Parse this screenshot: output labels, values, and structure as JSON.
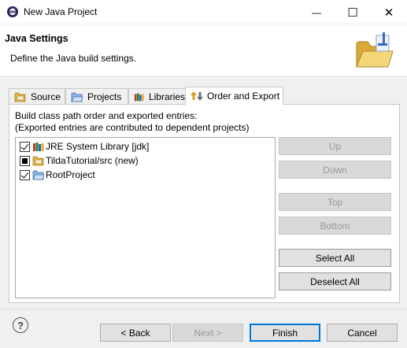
{
  "window": {
    "title": "New Java Project",
    "controls": {
      "minimize": "—",
      "maximize": "☐",
      "close": "✕"
    }
  },
  "header": {
    "title": "Java Settings",
    "subtitle": "Define the Java build settings."
  },
  "tabs": [
    {
      "label": "Source",
      "icon": "source-folder-icon",
      "active": false
    },
    {
      "label": "Projects",
      "icon": "projects-folder-icon",
      "active": false
    },
    {
      "label": "Libraries",
      "icon": "libraries-icon",
      "active": false
    },
    {
      "label": "Order and Export",
      "icon": "order-export-icon",
      "active": true
    }
  ],
  "panel": {
    "description_line1": "Build class path order and exported entries:",
    "description_line2": "(Exported entries are contributed to dependent projects)",
    "entries": [
      {
        "label": "JRE System Library [jdk]",
        "state": "checked",
        "icon": "jre-library-icon"
      },
      {
        "label": "TildaTutorial/src (new)",
        "state": "mixed",
        "icon": "source-folder-icon"
      },
      {
        "label": "RootProject",
        "state": "checked",
        "icon": "project-folder-icon"
      }
    ],
    "buttons": {
      "up": "Up",
      "down": "Down",
      "top": "Top",
      "bottom": "Bottom",
      "select_all": "Select All",
      "deselect_all": "Deselect All"
    }
  },
  "footer": {
    "help": "?",
    "back": "< Back",
    "next": "Next >",
    "finish": "Finish",
    "cancel": "Cancel"
  },
  "colors": {
    "accent": "#0078d7",
    "dialog_bg": "#f0f0f0",
    "disabled_text": "#9a9a9a"
  }
}
